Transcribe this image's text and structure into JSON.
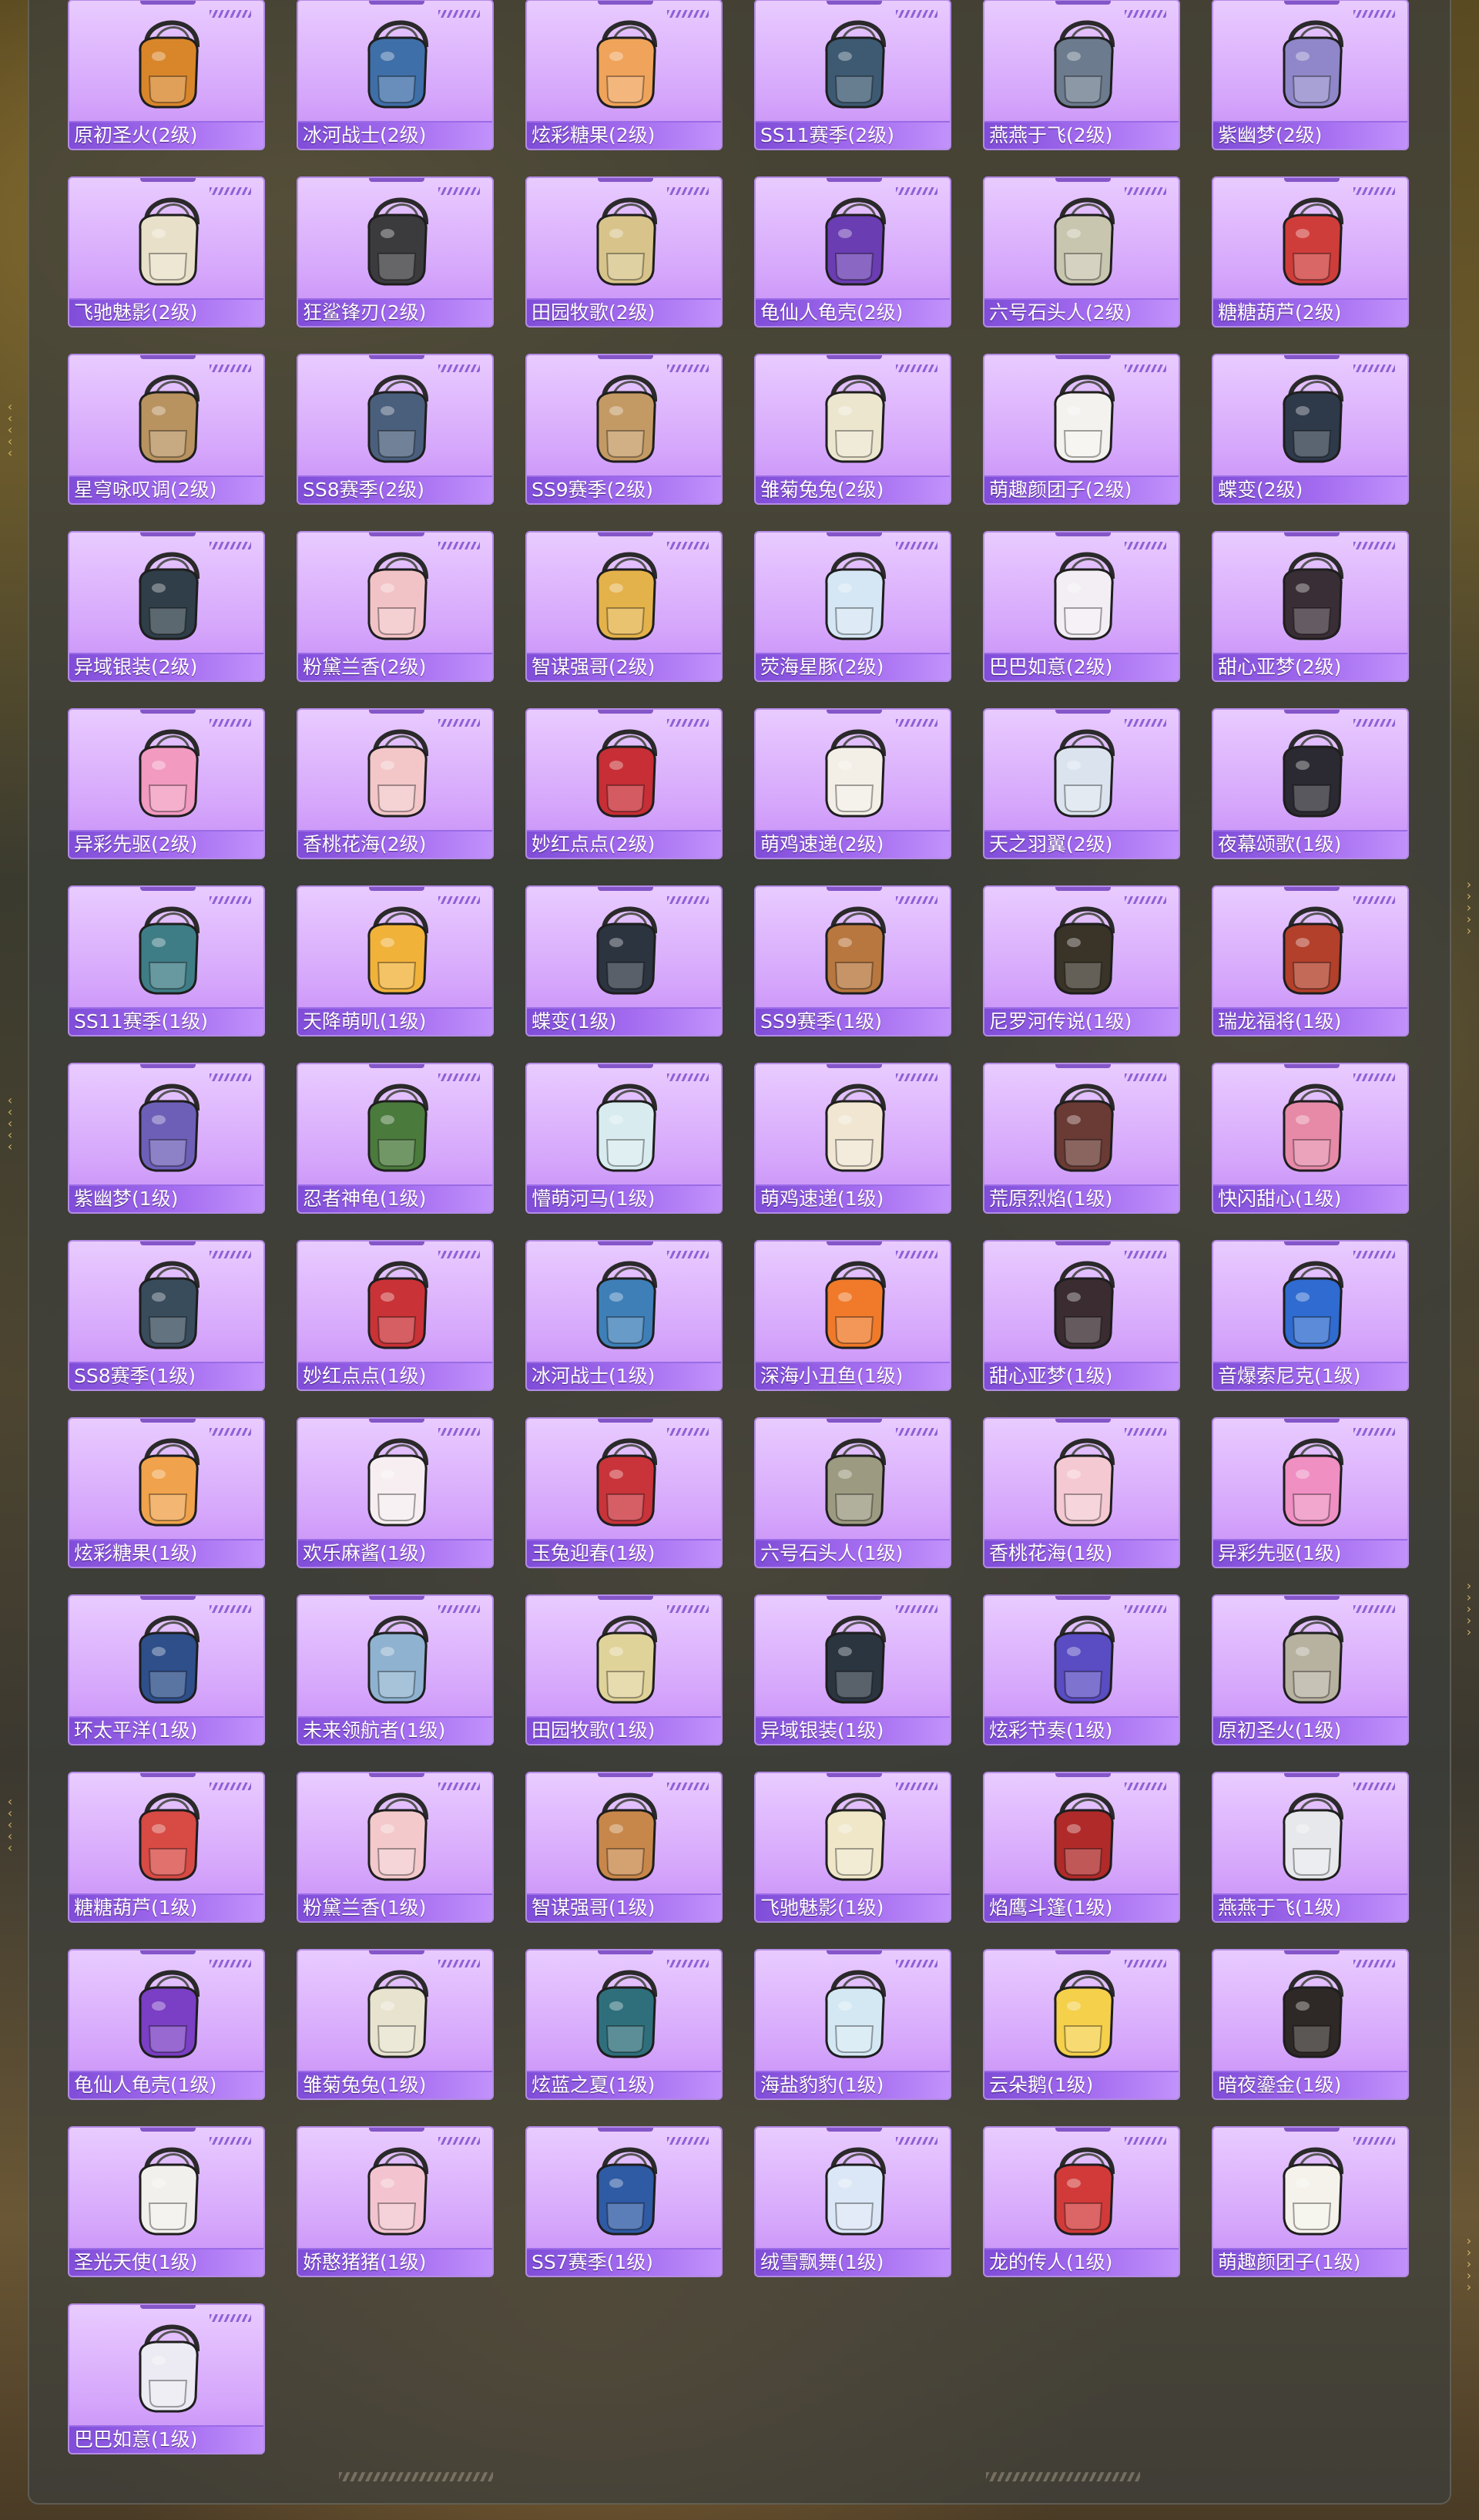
{
  "items": [
    {
      "label": "原初圣火(2级)",
      "color": "#d9862b"
    },
    {
      "label": "冰河战士(2级)",
      "color": "#3f6fa8"
    },
    {
      "label": "炫彩糖果(2级)",
      "color": "#f0a35a"
    },
    {
      "label": "SS11赛季(2级)",
      "color": "#3d5a72"
    },
    {
      "label": "燕燕于飞(2级)",
      "color": "#6c7b8e"
    },
    {
      "label": "紫幽梦(2级)",
      "color": "#8f87c9"
    },
    {
      "label": "飞驰魅影(2级)",
      "color": "#e8e0c8"
    },
    {
      "label": "狂鲨锋刃(2级)",
      "color": "#3b3a3d"
    },
    {
      "label": "田园牧歌(2级)",
      "color": "#d8c48a"
    },
    {
      "label": "龟仙人龟壳(2级)",
      "color": "#6a3db3"
    },
    {
      "label": "六号石头人(2级)",
      "color": "#c9c6b0"
    },
    {
      "label": "糖糖葫芦(2级)",
      "color": "#cf3d3a"
    },
    {
      "label": "星穹咏叹调(2级)",
      "color": "#b8935f"
    },
    {
      "label": "SS8赛季(2级)",
      "color": "#4a5f7c"
    },
    {
      "label": "SS9赛季(2级)",
      "color": "#c49a64"
    },
    {
      "label": "雏菊兔兔(2级)",
      "color": "#ece6cf"
    },
    {
      "label": "萌趣颜团子(2级)",
      "color": "#f4f2ee"
    },
    {
      "label": "蝶变(2级)",
      "color": "#2e3a4a"
    },
    {
      "label": "异域银装(2级)",
      "color": "#2f3e48"
    },
    {
      "label": "粉黛兰香(2级)",
      "color": "#f2c3c6"
    },
    {
      "label": "智谋强哥(2级)",
      "color": "#e4b24a"
    },
    {
      "label": "荧海星豚(2级)",
      "color": "#d5e6f4"
    },
    {
      "label": "巴巴如意(2级)",
      "color": "#f3eef4"
    },
    {
      "label": "甜心亚梦(2级)",
      "color": "#3a2e36"
    },
    {
      "label": "异彩先驱(2级)",
      "color": "#f29ac0"
    },
    {
      "label": "香桃花海(2级)",
      "color": "#f3c6c8"
    },
    {
      "label": "妙红点点(2级)",
      "color": "#c72e35"
    },
    {
      "label": "萌鸡速递(2级)",
      "color": "#f3efe6"
    },
    {
      "label": "天之羽翼(2级)",
      "color": "#dbe4ee"
    },
    {
      "label": "夜幕颂歌(1级)",
      "color": "#2b2a32"
    },
    {
      "label": "SS11赛季(1级)",
      "color": "#3f7d86"
    },
    {
      "label": "天降萌叽(1级)",
      "color": "#f1b23a"
    },
    {
      "label": "蝶变(1级)",
      "color": "#2c3440"
    },
    {
      "label": "SS9赛季(1级)",
      "color": "#b8773e"
    },
    {
      "label": "尼罗河传说(1级)",
      "color": "#3a3428"
    },
    {
      "label": "瑞龙福将(1级)",
      "color": "#b2402b"
    },
    {
      "label": "紫幽梦(1级)",
      "color": "#6d5fb8"
    },
    {
      "label": "忍者神龟(1级)",
      "color": "#4a7a3c"
    },
    {
      "label": "懵萌河马(1级)",
      "color": "#d8ecef"
    },
    {
      "label": "萌鸡速递(1级)",
      "color": "#f0e6d2"
    },
    {
      "label": "荒原烈焰(1级)",
      "color": "#6a3a34"
    },
    {
      "label": "快闪甜心(1级)",
      "color": "#e68aa8"
    },
    {
      "label": "SS8赛季(1级)",
      "color": "#384c5c"
    },
    {
      "label": "妙红点点(1级)",
      "color": "#c93236"
    },
    {
      "label": "冰河战士(1级)",
      "color": "#3e7fb8"
    },
    {
      "label": "深海小丑鱼(1级)",
      "color": "#f07a2a"
    },
    {
      "label": "甜心亚梦(1级)",
      "color": "#3a2c30"
    },
    {
      "label": "音爆索尼克(1级)",
      "color": "#2f6bd0"
    },
    {
      "label": "炫彩糖果(1级)",
      "color": "#f0a34c"
    },
    {
      "label": "欢乐麻酱(1级)",
      "color": "#f6eef0"
    },
    {
      "label": "玉兔迎春(1级)",
      "color": "#c9333a"
    },
    {
      "label": "六号石头人(1级)",
      "color": "#9c9a80"
    },
    {
      "label": "香桃花海(1级)",
      "color": "#f4c9d2"
    },
    {
      "label": "异彩先驱(1级)",
      "color": "#ef8fc2"
    },
    {
      "label": "环太平洋(1级)",
      "color": "#2e4f8a"
    },
    {
      "label": "未来领航者(1级)",
      "color": "#8fb2d0"
    },
    {
      "label": "田园牧歌(1级)",
      "color": "#e0d39a"
    },
    {
      "label": "异域银装(1级)",
      "color": "#2b3540"
    },
    {
      "label": "炫彩节奏(1级)",
      "color": "#5a4cc2"
    },
    {
      "label": "原初圣火(1级)",
      "color": "#b7b1a0"
    },
    {
      "label": "糖糖葫芦(1级)",
      "color": "#d84a44"
    },
    {
      "label": "粉黛兰香(1级)",
      "color": "#f3c9cc"
    },
    {
      "label": "智谋强哥(1级)",
      "color": "#c8874a"
    },
    {
      "label": "飞驰魅影(1级)",
      "color": "#efe7c8"
    },
    {
      "label": "焰鹰斗篷(1级)",
      "color": "#b02a2a"
    },
    {
      "label": "燕燕于飞(1级)",
      "color": "#e6e8ec"
    },
    {
      "label": "龟仙人龟壳(1级)",
      "color": "#7a3fc4"
    },
    {
      "label": "雏菊兔兔(1级)",
      "color": "#e8e3cf"
    },
    {
      "label": "炫蓝之夏(1级)",
      "color": "#2f6f7c"
    },
    {
      "label": "海盐豹豹(1级)",
      "color": "#d4e8f4"
    },
    {
      "label": "云朵鹅(1级)",
      "color": "#f5d04a"
    },
    {
      "label": "暗夜鎏金(1级)",
      "color": "#2e2826"
    },
    {
      "label": "圣光天使(1级)",
      "color": "#f2f0ec"
    },
    {
      "label": "娇憨猪猪(1级)",
      "color": "#f3c4cf"
    },
    {
      "label": "SS7赛季(1级)",
      "color": "#2f5aa4"
    },
    {
      "label": "绒雪飘舞(1级)",
      "color": "#dbe6f6"
    },
    {
      "label": "龙的传人(1级)",
      "color": "#d23a3a"
    },
    {
      "label": "萌趣颜团子(1级)",
      "color": "#f4f2ea"
    },
    {
      "label": "巴巴如意(1级)",
      "color": "#eceaf2"
    }
  ]
}
